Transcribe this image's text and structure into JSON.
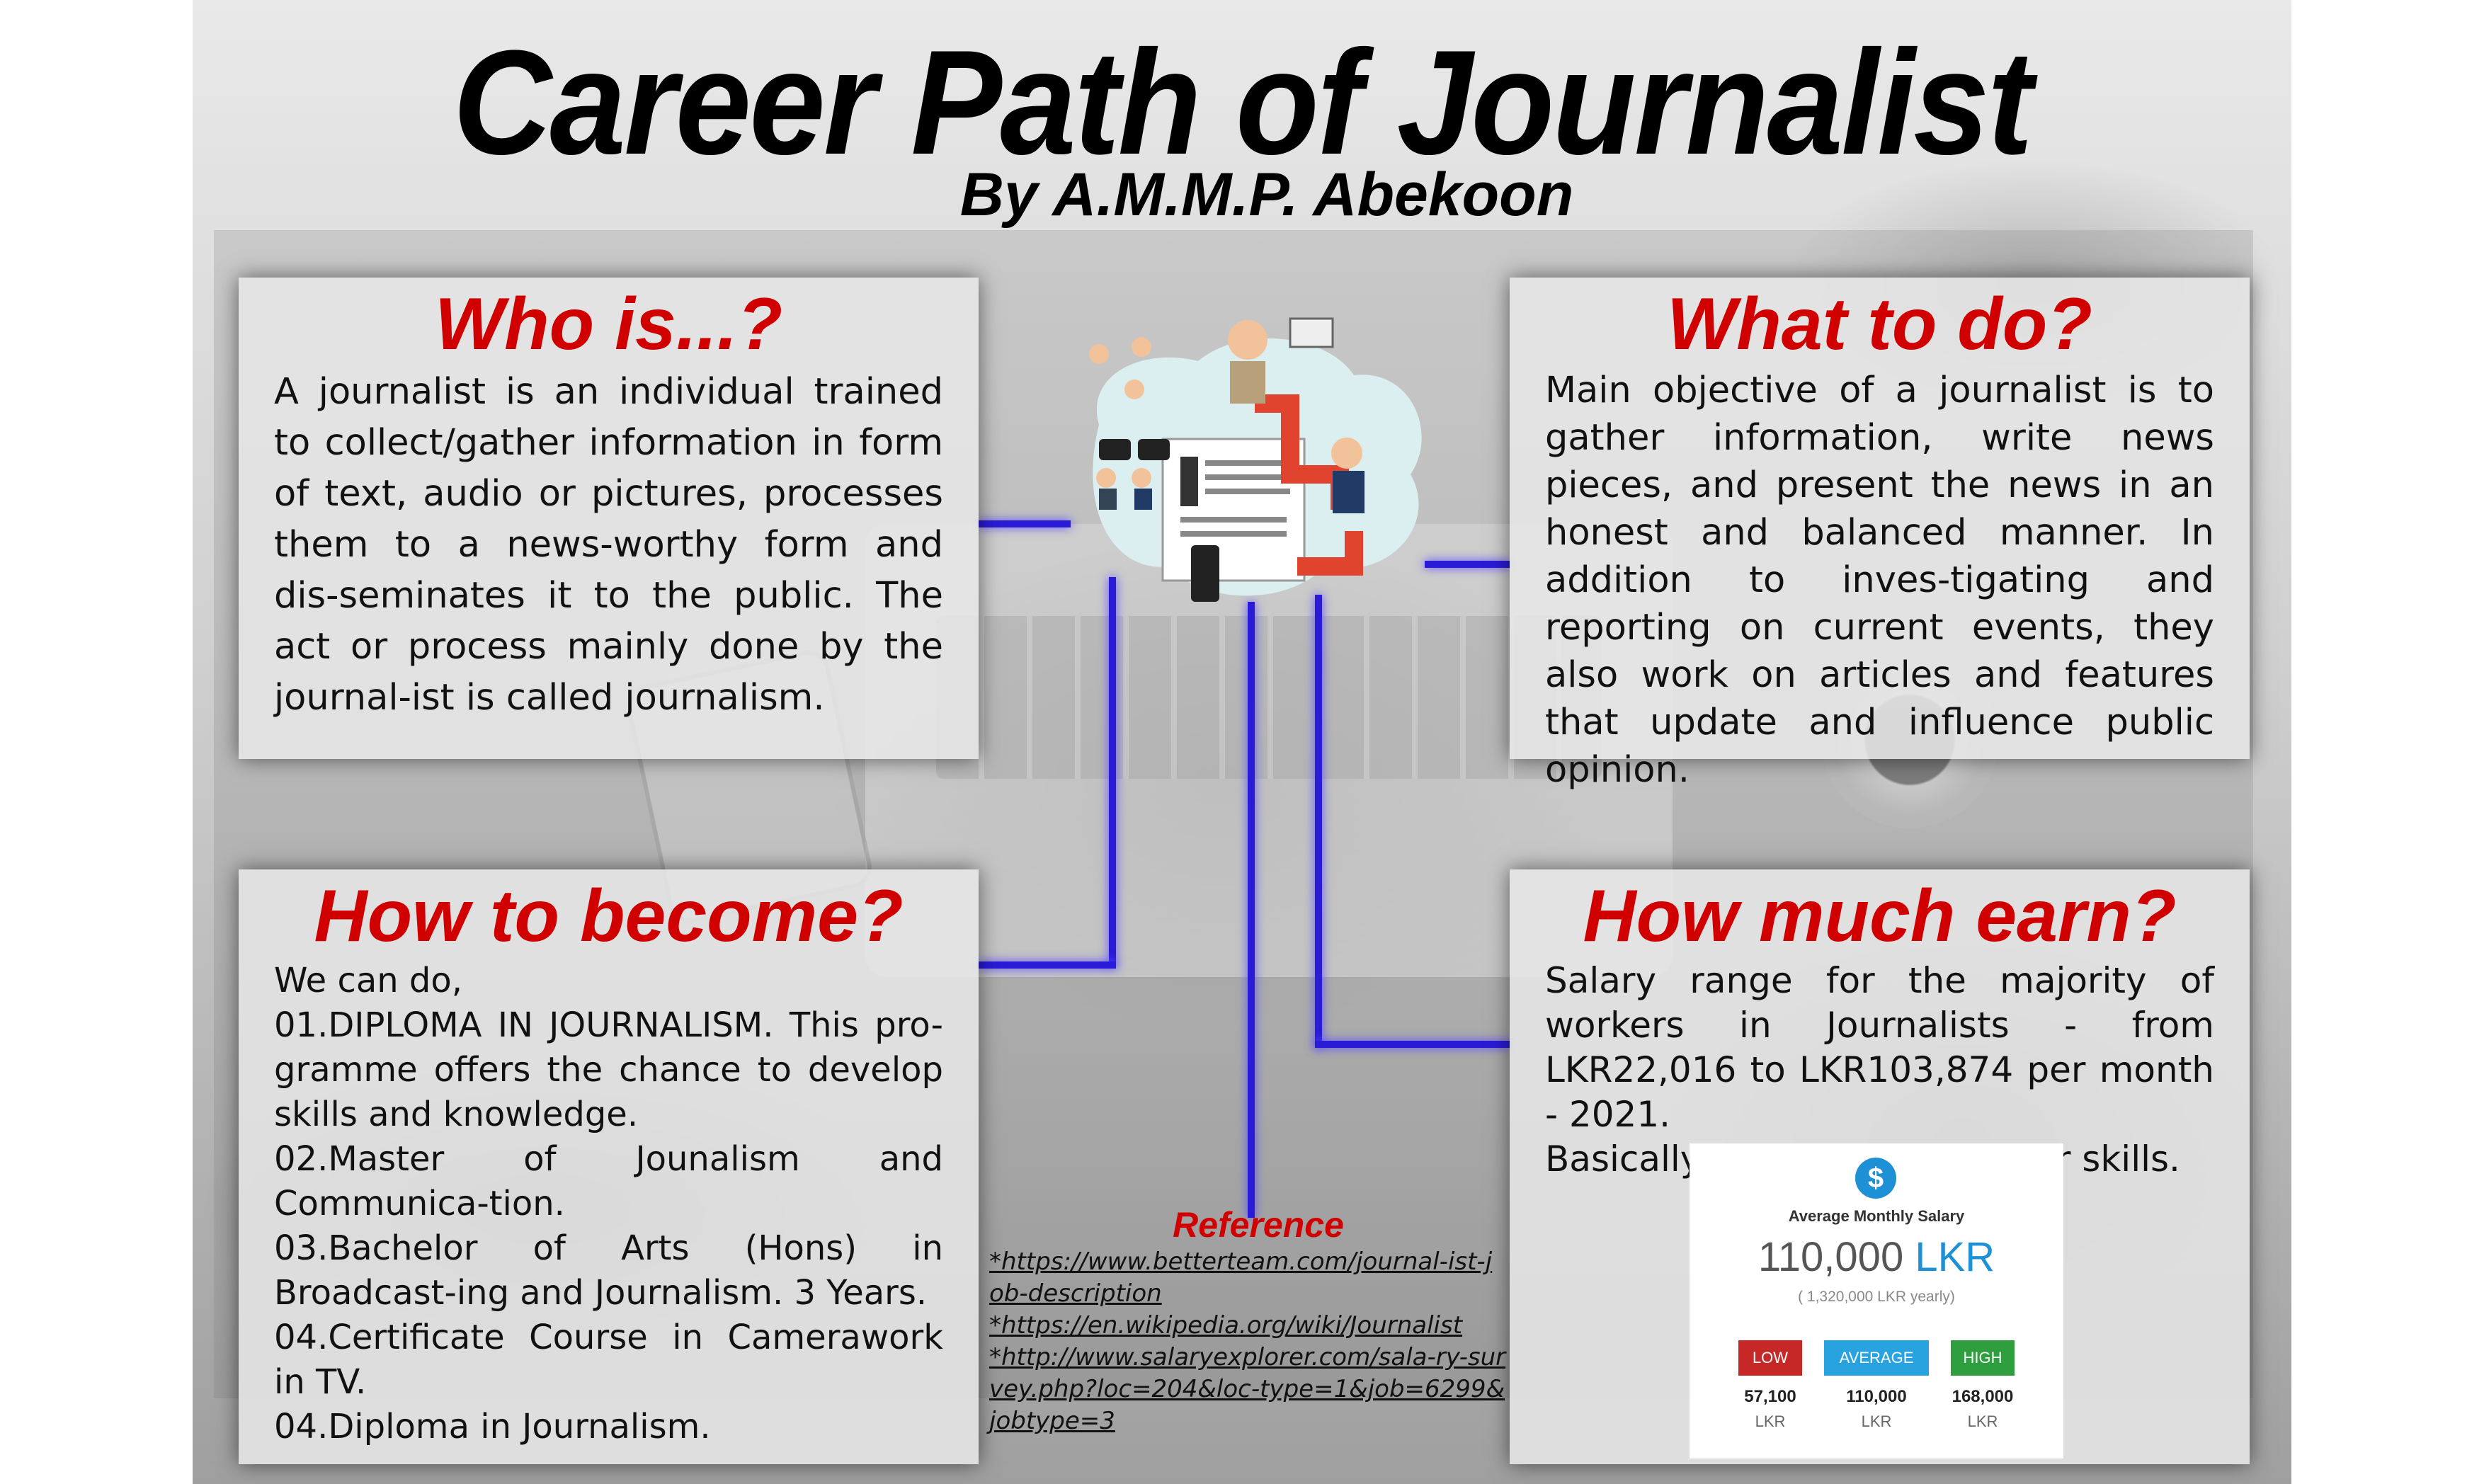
{
  "header": {
    "title": "Career Path of Journalist",
    "byline": "By A.M.M.P. Abekoon"
  },
  "who": {
    "title": "Who is...?",
    "text": "A journalist is an individual trained to collect/gather information in form of text, audio or pictures, processes them to a news-worthy form and dis-seminates it to the public. The act or process mainly done by the journal-ist is called journalism."
  },
  "what": {
    "title": "What to do?",
    "text": "Main objective of a journalist is to gather information, write news pieces, and present the news in an honest and balanced manner. In addition to inves-tigating and reporting on current events, they also work on articles and features that update and influence public opinion."
  },
  "how": {
    "title": "How to become?",
    "lines": [
      "We can do,",
      "01.DIPLOMA IN JOURNALISM. This pro-gramme offers the chance to develop skills and knowledge.",
      "02.Master of Jounalism and Communica-tion.",
      "03.Bachelor of Arts (Hons) in Broadcast-ing and Journalism. 3 Years.",
      "04.Certificate Course in Camerawork in TV.",
      "04.Diploma in Journalism."
    ]
  },
  "earn": {
    "title": "How much earn?",
    "text": "Salary range for the majority of workers in Journalists - from LKR22,016 to LKR103,874 per month - 2021.",
    "note": "Basically this depend on their skills."
  },
  "salary_card": {
    "icon": "dollar-icon",
    "heading": "Average Monthly Salary",
    "average_value": "110,000",
    "average_currency": "LKR",
    "yearly": "( 1,320,000 LKR yearly)",
    "tiers": [
      {
        "label": "LOW",
        "value": "57,100",
        "currency": "LKR",
        "color": "#c62828"
      },
      {
        "label": "AVERAGE",
        "value": "110,000",
        "currency": "LKR",
        "color": "#29a3e0"
      },
      {
        "label": "HIGH",
        "value": "168,000",
        "currency": "LKR",
        "color": "#2e9e3e"
      }
    ]
  },
  "reference": {
    "title": "Reference",
    "links": [
      "*https://www.betterteam.com/journal-ist-job-description",
      "*https://en.wikipedia.org/wiki/Journalist",
      "*http://www.salaryexplorer.com/sala-ry-survey.php?loc=204&loc-type=1&job=6299&jobtype=3"
    ]
  },
  "colors": {
    "accent": "#d10000",
    "connector": "#2a1bd6"
  }
}
